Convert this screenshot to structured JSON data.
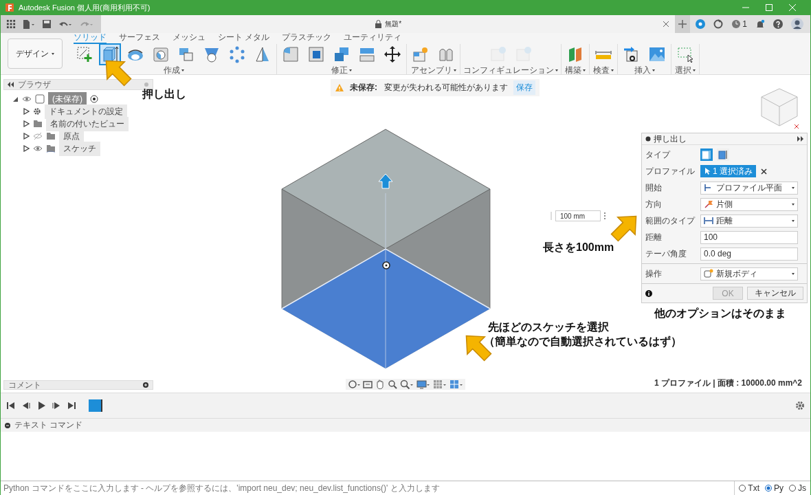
{
  "window": {
    "title": "Autodesk Fusion 個人用(商用利用不可)"
  },
  "document_tab": {
    "title": "無題*",
    "job_count": "1"
  },
  "workspace": {
    "label": "デザイン"
  },
  "ribbon_tabs": [
    {
      "label": "ソリッド",
      "selected": true
    },
    {
      "label": "サーフェス",
      "selected": false
    },
    {
      "label": "メッシュ",
      "selected": false
    },
    {
      "label": "シート メタル",
      "selected": false
    },
    {
      "label": "プラスチック",
      "selected": false
    },
    {
      "label": "ユーティリティ",
      "selected": false
    }
  ],
  "tool_groups": [
    {
      "label": "作成",
      "disabled": false,
      "tools": [
        {
          "kind": "sketch",
          "selected": false
        },
        {
          "kind": "extrude",
          "selected": true
        },
        {
          "kind": "revolve",
          "selected": false
        },
        {
          "kind": "hole",
          "selected": false
        },
        {
          "kind": "blocks",
          "selected": false
        },
        {
          "kind": "funnel",
          "selected": false
        },
        {
          "kind": "dots",
          "selected": false
        },
        {
          "kind": "rib",
          "selected": false
        }
      ]
    },
    {
      "label": "修正",
      "disabled": false,
      "tools": [
        {
          "kind": "fillet",
          "selected": false
        },
        {
          "kind": "shell",
          "selected": false
        },
        {
          "kind": "combine",
          "selected": false
        },
        {
          "kind": "split",
          "selected": false
        },
        {
          "kind": "move",
          "selected": false
        }
      ]
    },
    {
      "label": "アセンブリ",
      "disabled": false,
      "tools": [
        {
          "kind": "component",
          "selected": false
        },
        {
          "kind": "joint",
          "selected": false
        }
      ]
    },
    {
      "label": "コンフィギュレーション",
      "disabled": true,
      "tools": [
        {
          "kind": "table",
          "selected": false
        },
        {
          "kind": "table",
          "selected": false
        }
      ]
    },
    {
      "label": "構築",
      "disabled": false,
      "tools": [
        {
          "kind": "plane",
          "selected": false
        }
      ]
    },
    {
      "label": "検査",
      "disabled": false,
      "tools": [
        {
          "kind": "ruler",
          "selected": false
        }
      ]
    },
    {
      "label": "挿入",
      "disabled": false,
      "tools": [
        {
          "kind": "insert",
          "selected": false
        },
        {
          "kind": "image",
          "selected": false
        }
      ]
    },
    {
      "label": "選択",
      "disabled": false,
      "tools": [
        {
          "kind": "select",
          "selected": false
        }
      ]
    }
  ],
  "browser": {
    "title": "ブラウザ",
    "tree": [
      {
        "label": "(未保存)",
        "kind": "component",
        "visible": true,
        "expanded": true,
        "children": [
          {
            "label": "ドキュメントの設定",
            "kind": "settings",
            "expanded": false
          },
          {
            "label": "名前の付いたビュー",
            "kind": "folder",
            "expanded": false
          },
          {
            "label": "原点",
            "kind": "folder",
            "visible": false,
            "expanded": false
          },
          {
            "label": "スケッチ",
            "kind": "sketches",
            "visible": true,
            "expanded": false
          }
        ]
      }
    ]
  },
  "warning": {
    "title": "未保存:",
    "message": "変更が失われる可能性があります",
    "action": "保存"
  },
  "dimension_input": {
    "value": "100 mm"
  },
  "extrude_dialog": {
    "title": "押し出し",
    "sections": [
      [
        {
          "label": "タイプ",
          "kind": "toggle",
          "options": [
            {
              "selected": true
            },
            {
              "selected": false
            }
          ]
        },
        {
          "label": "プロファイル",
          "kind": "selection",
          "value": "1 選択済み"
        },
        {
          "label": "開始",
          "kind": "dropdown",
          "value": "プロファイル平面"
        },
        {
          "label": "方向",
          "kind": "dropdown",
          "value": "片側"
        },
        {
          "label": "範囲のタイプ",
          "kind": "dropdown",
          "value": "距離"
        },
        {
          "label": "距離",
          "kind": "input",
          "value": "100"
        },
        {
          "label": "テーパ角度",
          "kind": "input",
          "value": "0.0 deg"
        }
      ],
      [
        {
          "label": "操作",
          "kind": "dropdown",
          "value": "新規ボディ"
        }
      ]
    ],
    "buttons": [
      {
        "label": "OK",
        "disabled": true
      },
      {
        "label": "キャンセル",
        "disabled": false
      }
    ]
  },
  "comments": {
    "title": "コメント"
  },
  "status": "1 プロファイル | 面積 : 10000.00 mm^2",
  "text_commands": {
    "title": "テキスト コマンド",
    "placeholder": "Python コマンドをここに入力します - ヘルプを参照するには、'import neu_dev; neu_dev.list_functions()' と入力します",
    "modes": [
      {
        "label": "Txt",
        "selected": false
      },
      {
        "label": "Py",
        "selected": true
      },
      {
        "label": "Js",
        "selected": false
      }
    ]
  },
  "annotations": [
    {
      "text": "押し出し",
      "arrow": true
    },
    {
      "text": "長さを100mm",
      "arrow": true
    },
    {
      "text": "他のオプションはそのまま",
      "arrow": false
    },
    {
      "text": "先ほどのスケッチを選択",
      "arrow": true
    },
    {
      "text": "（簡単なので自動選択されているはず）",
      "arrow": false
    }
  ]
}
